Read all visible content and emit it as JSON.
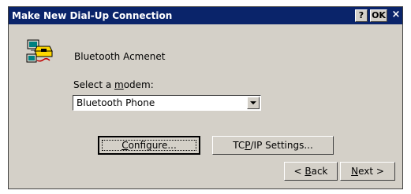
{
  "window": {
    "title": "Make New Dial-Up Connection",
    "help_button": "?",
    "ok_button": "OK",
    "close_button": "×"
  },
  "connection": {
    "icon": "dialup-connection-icon",
    "name": "Bluetooth Acmenet"
  },
  "modem": {
    "label_prefix": "Select a ",
    "label_mnemonic": "m",
    "label_suffix": "odem:",
    "selected": "Bluetooth Phone"
  },
  "buttons": {
    "configure_mnemonic": "C",
    "configure_rest": "onfigure...",
    "tcpip_pre": "TC",
    "tcpip_mnemonic": "P",
    "tcpip_post": "/IP Settings...",
    "back_pre": "< ",
    "back_mnemonic": "B",
    "back_post": "ack",
    "next_mnemonic": "N",
    "next_post": "ext >"
  }
}
